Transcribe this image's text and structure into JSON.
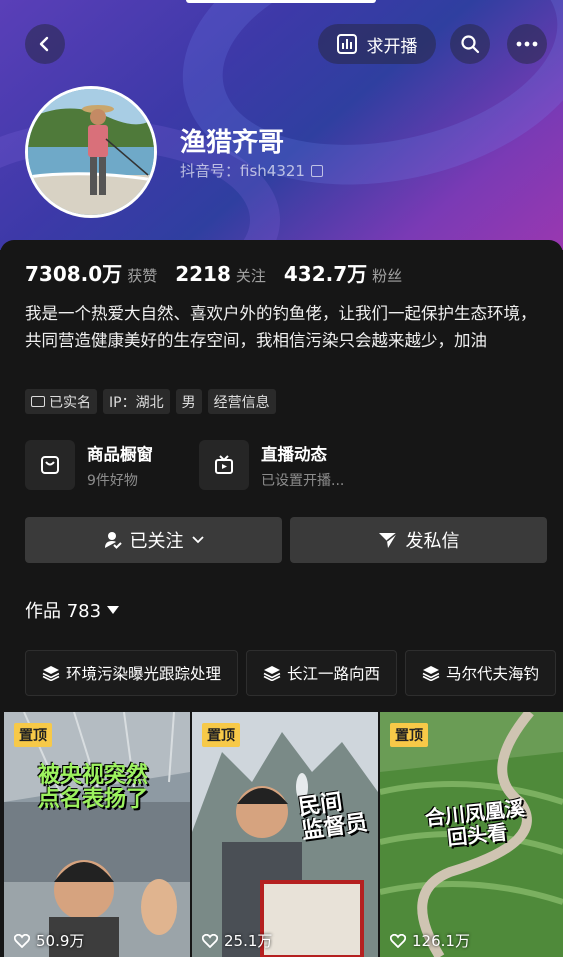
{
  "nav": {
    "live_label": "求开播"
  },
  "profile": {
    "name": "渔猎齐哥",
    "douyin_id": "抖音号：fish4321"
  },
  "stats": {
    "likes_value": "7308.0万",
    "likes_label": "获赞",
    "following_value": "2218",
    "following_label": "关注",
    "fans_value": "432.7万",
    "fans_label": "粉丝"
  },
  "bio": "我是一个热爱大自然、喜欢户外的钓鱼佬，让我们一起保护生态环境，共同营造健康美好的生存空间，我相信污染只会越来越少，加油",
  "tags": [
    "已实名",
    "IP：湖北",
    "男",
    "经营信息"
  ],
  "shop": {
    "title": "商品橱窗",
    "sub": "9件好物"
  },
  "live": {
    "title": "直播动态",
    "sub": "已设置开播..."
  },
  "buttons": {
    "followed": "已关注",
    "message": "发私信"
  },
  "works": {
    "label": "作品 783"
  },
  "collections": [
    "环境污染曝光跟踪处理",
    "长江一路向西",
    "马尔代夫海钓"
  ],
  "videos": [
    {
      "pin": "置顶",
      "likes": "50.9万",
      "caption": "被央视突然\n点名表扬了"
    },
    {
      "pin": "置顶",
      "likes": "25.1万",
      "caption": "民间\n监督员"
    },
    {
      "pin": "置顶",
      "likes": "126.1万",
      "caption": "合川凤凰溪\n回头看"
    }
  ],
  "colors": {
    "accent_yellow": "#f7c948",
    "header_purple": "#5a3fb8",
    "background": "#161616"
  }
}
